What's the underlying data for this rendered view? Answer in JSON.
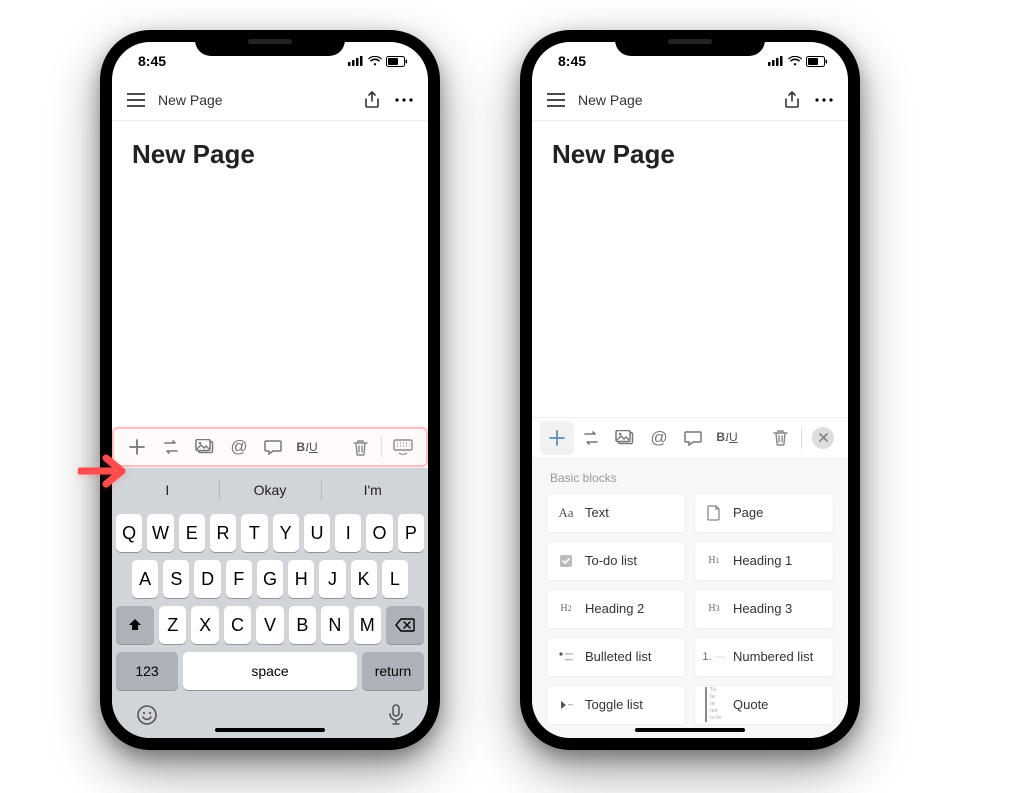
{
  "status": {
    "time": "8:45"
  },
  "nav": {
    "title": "New Page"
  },
  "page": {
    "title": "New Page"
  },
  "keyboard": {
    "suggestions": [
      "I",
      "Okay",
      "I'm"
    ],
    "row1": [
      "Q",
      "W",
      "E",
      "R",
      "T",
      "Y",
      "U",
      "I",
      "O",
      "P"
    ],
    "row2": [
      "A",
      "S",
      "D",
      "F",
      "G",
      "H",
      "J",
      "K",
      "L"
    ],
    "row3": [
      "Z",
      "X",
      "C",
      "V",
      "B",
      "N",
      "M"
    ],
    "num_label": "123",
    "space_label": "space",
    "return_label": "return"
  },
  "blocks": {
    "header": "Basic blocks",
    "items": [
      {
        "label": "Text",
        "icon": "Aa"
      },
      {
        "label": "Page",
        "icon": "page"
      },
      {
        "label": "To-do list",
        "icon": "todo"
      },
      {
        "label": "Heading 1",
        "icon": "H1"
      },
      {
        "label": "Heading 2",
        "icon": "H2"
      },
      {
        "label": "Heading 3",
        "icon": "H3"
      },
      {
        "label": "Bulleted list",
        "icon": "bullet"
      },
      {
        "label": "Numbered list",
        "icon": "1."
      },
      {
        "label": "Toggle list",
        "icon": "toggle"
      },
      {
        "label": "Quote",
        "icon": "quote"
      }
    ]
  },
  "toolbar": {
    "biu": "BIU"
  }
}
